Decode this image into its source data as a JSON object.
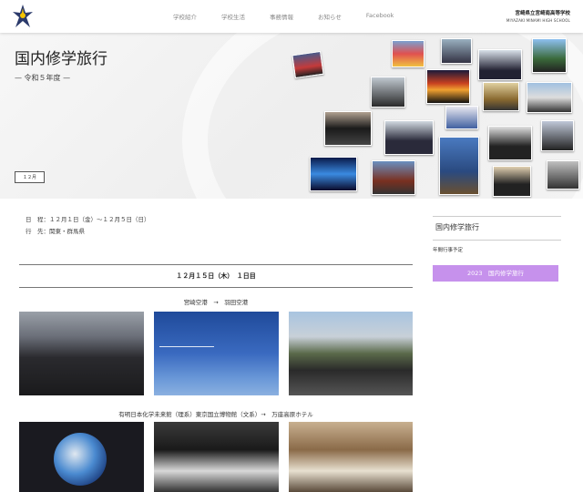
{
  "header": {
    "nav": [
      "学校紹介",
      "学校生活",
      "事務情報",
      "お知らせ",
      "Facebook"
    ],
    "school_name_jp": "宮崎県立宮崎南高等学校",
    "school_name_en": "MIYAZAKI MINAMI HIGH SCHOOL"
  },
  "hero": {
    "title": "国内修学旅行",
    "subtitle": "— 令和５年度 —",
    "tag": "１２月"
  },
  "info": {
    "schedule": "日　程：１２月１日（金）～１２月５日（日）",
    "destination": "行　先：関東・群馬県"
  },
  "sidebar": {
    "heading": "国内修学旅行",
    "link": "年間行事予定",
    "button": "2023　国内修学旅行"
  },
  "main": {
    "day_title": "１２月１５日（木）　１日目",
    "section1_caption": "宮崎空港　→　羽田空港",
    "section2_caption": "有明日本化学未来館（理系）東京国立博物館（文系）→　万座高原ホテル"
  }
}
